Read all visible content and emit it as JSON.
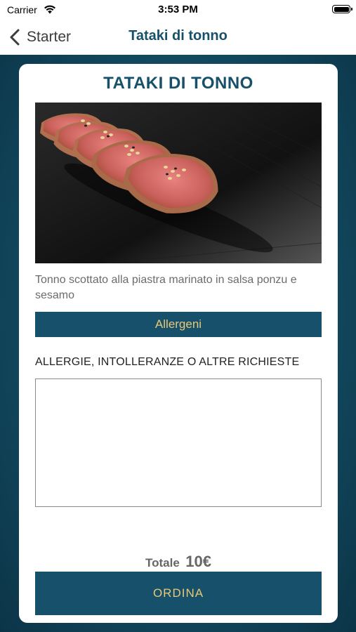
{
  "status_bar": {
    "carrier": "Carrier",
    "time": "3:53 PM",
    "icons": [
      "wifi-icon",
      "battery-icon"
    ]
  },
  "nav": {
    "back_label": "Starter",
    "title": "Tataki di tonno",
    "back_icon": "chevron-left-icon"
  },
  "dish": {
    "title": "TATAKI DI TONNO",
    "description": "Tonno scottato alla piastra marinato in salsa ponzu e sesamo",
    "allergens_label": "Allergeni",
    "requests_label": "ALLERGIE, INTOLLERANZE O ALTRE RICHIESTE",
    "requests_value": ""
  },
  "order": {
    "total_label": "Totale",
    "total_value": "10€",
    "order_label": "ORDINA"
  },
  "colors": {
    "brand": "#17506a",
    "button_text": "#e7c977",
    "background": "#134f66"
  }
}
